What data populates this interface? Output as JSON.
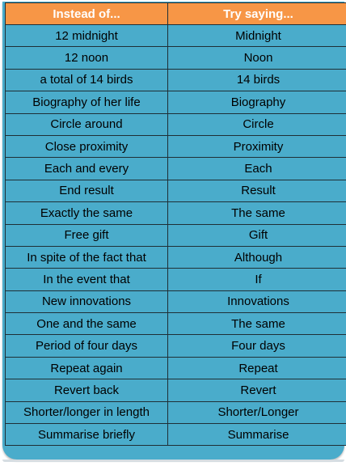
{
  "table": {
    "headers": [
      "Instead of...",
      "Try saying..."
    ],
    "rows": [
      [
        "12 midnight",
        "Midnight"
      ],
      [
        "12 noon",
        "Noon"
      ],
      [
        "a total of 14 birds",
        "14 birds"
      ],
      [
        "Biography of her life",
        "Biography"
      ],
      [
        "Circle around",
        "Circle"
      ],
      [
        "Close proximity",
        "Proximity"
      ],
      [
        "Each and every",
        "Each"
      ],
      [
        "End result",
        "Result"
      ],
      [
        "Exactly the same",
        "The same"
      ],
      [
        "Free gift",
        "Gift"
      ],
      [
        "In spite of the fact that",
        "Although"
      ],
      [
        "In the event that",
        "If"
      ],
      [
        "New innovations",
        "Innovations"
      ],
      [
        "One and the same",
        "The same"
      ],
      [
        "Period of four days",
        "Four days"
      ],
      [
        "Repeat again",
        "Repeat"
      ],
      [
        "Revert back",
        "Revert"
      ],
      [
        "Shorter/longer in length",
        "Shorter/Longer"
      ],
      [
        "Summarise briefly",
        "Summarise"
      ]
    ]
  },
  "colors": {
    "header_background": "#f79646",
    "row_background": "#4aaccb",
    "border": "#1f2f36",
    "header_text": "#ffffff",
    "body_text": "#000000"
  }
}
